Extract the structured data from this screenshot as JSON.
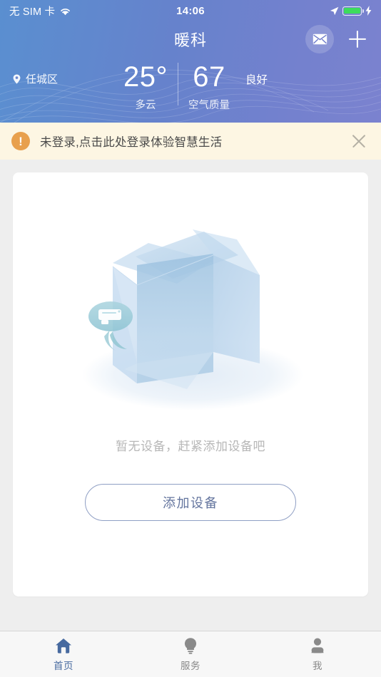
{
  "colors": {
    "header_gradient_start": "#5a8fd0",
    "header_gradient_end": "#7b82cf",
    "notice_bg": "#fdf6e3",
    "notice_icon": "#e8a04d",
    "accent_blue": "#46699f",
    "button_border": "#8f9fc4",
    "button_text": "#64759e",
    "page_bg": "#eeeeee",
    "battery_green": "#3ddc5c"
  },
  "statusbar": {
    "carrier": "无 SIM 卡",
    "wifi_icon": "wifi-icon",
    "time": "14:06",
    "location_icon": "location-arrow-icon",
    "battery_icon": "battery-icon",
    "charging_icon": "charging-bolt-icon"
  },
  "titlebar": {
    "title": "暖科",
    "mail_icon": "mail-icon",
    "add_icon": "plus-icon"
  },
  "weather": {
    "location_icon": "location-pin-icon",
    "location": "任城区",
    "temperature": "25°",
    "condition": "多云",
    "aqi_value": "67",
    "aqi_label": "空气质量",
    "aqi_quality": "良好"
  },
  "notice": {
    "icon": "exclamation-icon",
    "icon_glyph": "!",
    "message": "未登录,点击此处登录体验智慧生活",
    "close_icon": "close-icon"
  },
  "empty_state": {
    "illustration": "empty-box-illustration",
    "message": "暂无设备，赶紧添加设备吧",
    "button_label": "添加设备"
  },
  "tabbar": {
    "items": [
      {
        "label": "首页",
        "icon": "home-icon",
        "active": true
      },
      {
        "label": "服务",
        "icon": "lightbulb-icon",
        "active": false
      },
      {
        "label": "我",
        "icon": "person-icon",
        "active": false
      }
    ]
  }
}
